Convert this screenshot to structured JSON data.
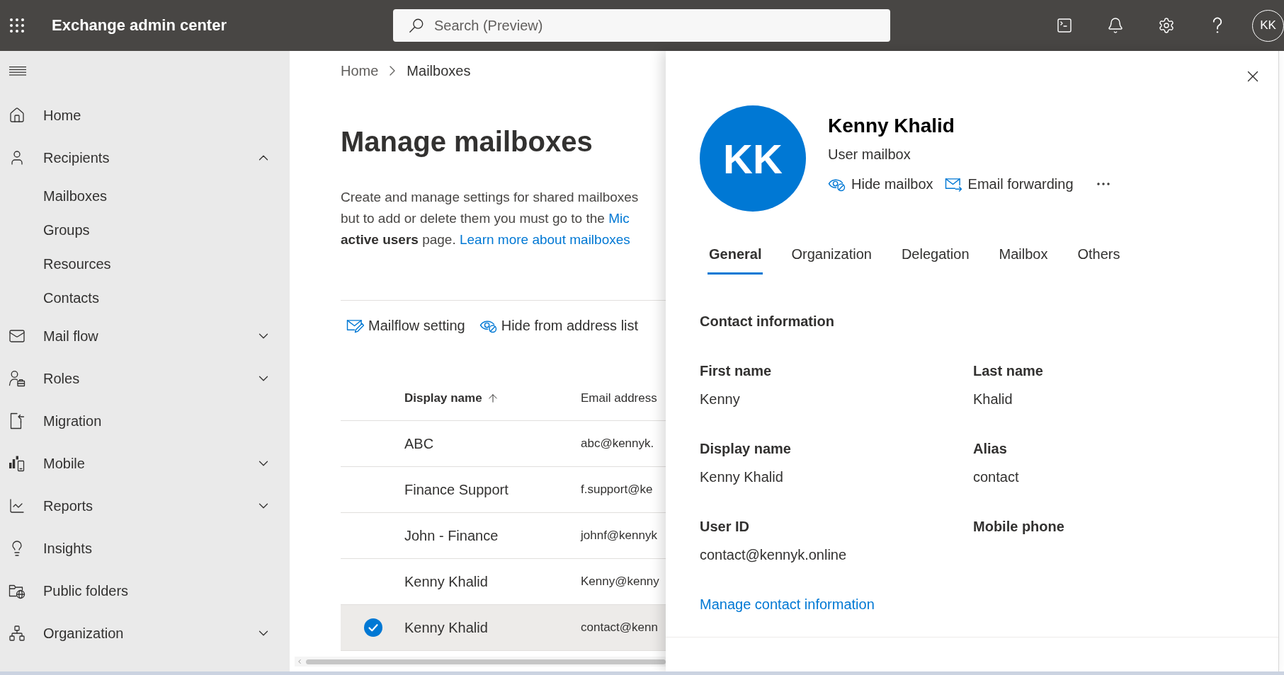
{
  "top_bar": {
    "title": "Exchange admin center",
    "search": {
      "placeholder": "Search (Preview)"
    },
    "account": {
      "initials": "KK"
    }
  },
  "sidebar": {
    "items": [
      {
        "label": "Home",
        "kind": "link"
      },
      {
        "label": "Recipients",
        "kind": "group",
        "expanded": true,
        "children": [
          {
            "label": "Mailboxes"
          },
          {
            "label": "Groups"
          },
          {
            "label": "Resources"
          },
          {
            "label": "Contacts"
          }
        ]
      },
      {
        "label": "Mail flow",
        "kind": "group",
        "expanded": false
      },
      {
        "label": "Roles",
        "kind": "group",
        "expanded": false
      },
      {
        "label": "Migration",
        "kind": "link"
      },
      {
        "label": "Mobile",
        "kind": "group",
        "expanded": false
      },
      {
        "label": "Reports",
        "kind": "group",
        "expanded": false
      },
      {
        "label": "Insights",
        "kind": "link"
      },
      {
        "label": "Public folders",
        "kind": "link"
      },
      {
        "label": "Organization",
        "kind": "group",
        "expanded": false
      }
    ]
  },
  "breadcrumb": [
    "Home",
    "Mailboxes"
  ],
  "page": {
    "title": "Manage mailboxes",
    "description": {
      "line_1": "Create and manage settings for shared mailboxes",
      "line_2": "but to add or delete them you must go to the",
      "line_2_link": "Mic",
      "line_3": "**active users** page.",
      "link": "Learn more about mailboxes"
    }
  },
  "toolbar": [
    {
      "label": "Mailflow setting",
      "kind": "mailflow"
    },
    {
      "label": "Hide from address list",
      "kind": "hide"
    }
  ],
  "table": {
    "columns": [
      {
        "label": "Display name",
        "sorted": true
      },
      {
        "label": "Email address",
        "sorted": false
      }
    ],
    "rows": [
      {
        "display_name": "ABC",
        "email": "abc@kennyk.",
        "selected": false
      },
      {
        "display_name": "Finance Support",
        "email": "f.support@ke",
        "selected": false
      },
      {
        "display_name": "John - Finance",
        "email": "johnf@kennyk",
        "selected": false
      },
      {
        "display_name": "Kenny Khalid",
        "email": "Kenny@kenny",
        "selected": false
      },
      {
        "display_name": "Kenny Khalid",
        "email": "contact@kenn",
        "selected": true
      }
    ]
  },
  "panel": {
    "avatar_initials": "KK",
    "name": "Kenny Khalid",
    "subtitle": "User mailbox",
    "actions": [
      {
        "label": "Hide mailbox",
        "kind": "hide"
      },
      {
        "label": "Email forwarding",
        "kind": "forward"
      }
    ],
    "tabs": [
      {
        "label": "General",
        "selected": true
      },
      {
        "label": "Organization",
        "selected": false
      },
      {
        "label": "Delegation",
        "selected": false
      },
      {
        "label": "Mailbox",
        "selected": false
      },
      {
        "label": "Others",
        "selected": false
      }
    ],
    "section_title": "Contact information",
    "fields": [
      {
        "label": "First name",
        "value": "Kenny"
      },
      {
        "label": "Last name",
        "value": "Khalid"
      },
      {
        "label": "Display name",
        "value": "Kenny Khalid"
      },
      {
        "label": "Alias",
        "value": "contact"
      },
      {
        "label": "User ID",
        "value": "contact@kennyk.online"
      },
      {
        "label": "Mobile phone"
      }
    ],
    "link": "Manage contact information"
  }
}
